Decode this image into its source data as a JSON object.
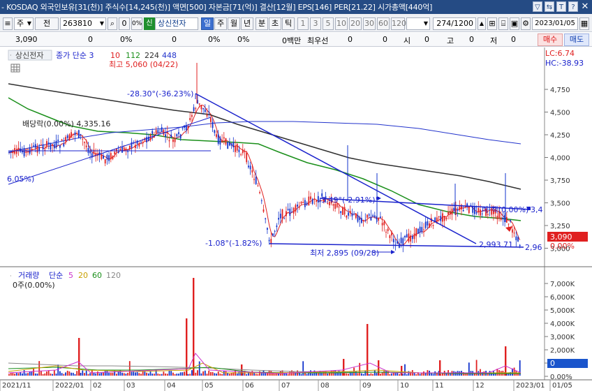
{
  "window": {
    "title": "- KOSDAQ 외국인보유[31(천)] 주식수[14,245(천)] 액면[500] 자본금[71(억)] 결산[12월] EPS[146] PER[21.22] 시가총액[440억]",
    "buttons": [
      "▽",
      "⇆",
      "T",
      "?"
    ],
    "close": "✕"
  },
  "toolbar": {
    "type_select": "주",
    "all_label": "전",
    "code_value": "263810",
    "period_sep": "0",
    "percent_toggle": "0%",
    "shin_badge": "신",
    "stock_name": "상신전자",
    "period_tabs": [
      "일",
      "주",
      "월",
      "년",
      "분",
      "초",
      "틱"
    ],
    "minute_tabs": [
      "1",
      "3",
      "5",
      "10",
      "20",
      "30",
      "60",
      "120"
    ],
    "count_value": "274/1200",
    "date_value": "2023/01/05",
    "icons": [
      "search-icon",
      "grid-icon",
      "save-icon",
      "settings-icon"
    ]
  },
  "price_info": {
    "price": "3,090",
    "change": "0",
    "change_pct": "0%",
    "volume": "0",
    "vol_pct": "0%",
    "vol_pct2": "0%",
    "trade_amount": "0백만",
    "priority_label": "최우선",
    "bid": "0",
    "ask": "0",
    "open_label": "시",
    "open": "0",
    "high_label": "고",
    "high": "0",
    "low_label": "저",
    "low": "0",
    "buy_label": "매수",
    "sell_label": "매도"
  },
  "price_panel": {
    "stock_tag": "상신전자",
    "indicator_label": "종가 단순 3",
    "ma_periods": [
      "10",
      "112",
      "224",
      "448"
    ],
    "ma_colors": [
      "#e02020",
      "#1a8f1a",
      "#303030",
      "#2233cc"
    ],
    "lc_label": "LC:6.74",
    "hc_label": "HC:-38.93",
    "high_annotation": "최고 5,060 (04/22)",
    "low_annotation": "최저 2,895 (09/28)",
    "dividend_annotation": "배당락(0.00%) 4,335.16",
    "trend1_label": "-28.30°(-36.23%)",
    "trend2_label": "-1.08°(-1.82%)",
    "trend3_label": "3.49°(-2.91%)",
    "trend3_value": "2,993.71",
    "trend3_end": "2,96",
    "left_pct": "6.05%)",
    "right_box_label": "마 잭(0.00%)",
    "right_box_value": "3,4",
    "current_price_tag": "3,090",
    "current_pct_tag": "0.00%",
    "y_ticks": [
      "4,750",
      "4,500",
      "4,250",
      "4,000",
      "3,750",
      "3,500",
      "3,250",
      "3,000"
    ]
  },
  "volume_panel": {
    "label": "거래량",
    "ma_label": "단순",
    "ma_periods": [
      "5",
      "20",
      "60",
      "120"
    ],
    "ma_colors": [
      "#cc33cc",
      "#c8a000",
      "#1a8f1a",
      "#888888"
    ],
    "sub_label": "0주(0.00%)",
    "y_ticks": [
      "7,000K",
      "6,000K",
      "5,000K",
      "4,000K",
      "3,000K",
      "2,000K",
      "1,000K",
      "0.00%"
    ],
    "current_tag": "0"
  },
  "x_axis": {
    "labels": [
      "2021/11",
      "2022/01",
      "02",
      "03",
      "04",
      "05",
      "06",
      "07",
      "08",
      "09",
      "10",
      "11",
      "12",
      "2023/01",
      "01/05"
    ]
  },
  "colors": {
    "title_bg": "#254b84",
    "up": "#e02020",
    "down": "#1133cc",
    "trendline": "#1a22cc"
  }
}
